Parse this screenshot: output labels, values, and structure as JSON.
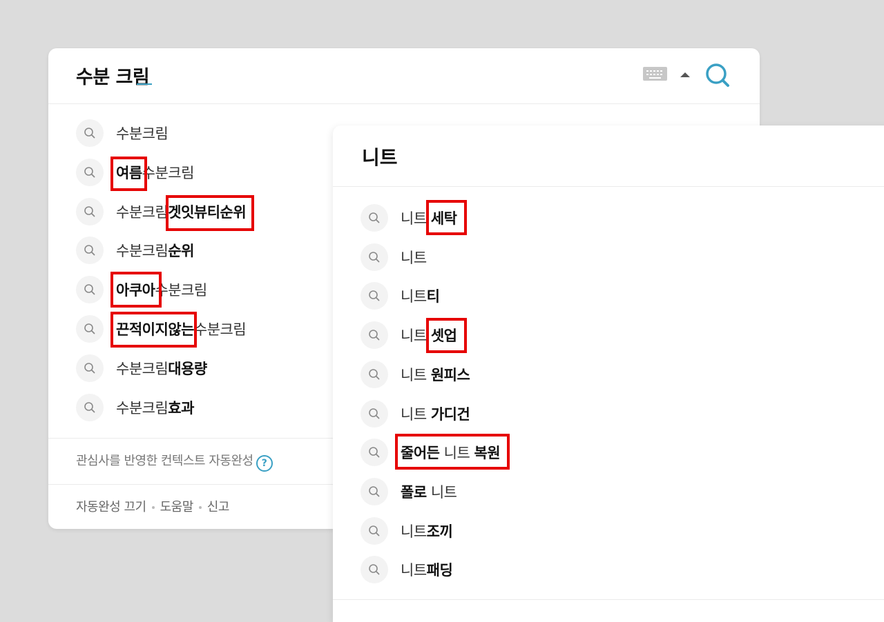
{
  "panel_a": {
    "query": "수분 크림",
    "search_button_label": "검색",
    "suggestions": [
      {
        "plain1": "수분크림",
        "bold": "",
        "plain2": ""
      },
      {
        "plain1": "",
        "bold": "여름",
        "plain2": "수분크림"
      },
      {
        "plain1": "수분크림",
        "bold": "겟잇뷰티순위",
        "plain2": ""
      },
      {
        "plain1": "수분크림",
        "bold": "순위",
        "plain2": ""
      },
      {
        "plain1": "",
        "bold": "아쿠아",
        "plain2": "수분크림"
      },
      {
        "plain1": "",
        "bold": "끈적이지않는",
        "plain2": "수분크림"
      },
      {
        "plain1": "수분크림",
        "bold": "대용량",
        "plain2": ""
      },
      {
        "plain1": "수분크림",
        "bold": "효과",
        "plain2": ""
      }
    ],
    "context_info": "관심사를 반영한 컨텍스트 자동완성",
    "help_icon": "?",
    "footer": {
      "autocomplete_off": "자동완성 끄기",
      "help": "도움말",
      "report": "신고"
    }
  },
  "panel_b": {
    "query": "니트",
    "suggestions": [
      {
        "plain1": "니트 ",
        "bold": "세탁",
        "plain2": ""
      },
      {
        "plain1": "니트",
        "bold": "",
        "plain2": ""
      },
      {
        "plain1": "니트",
        "bold": "티",
        "plain2": ""
      },
      {
        "plain1": "니트 ",
        "bold": "셋업",
        "plain2": ""
      },
      {
        "plain1": "니트 ",
        "bold": "원피스",
        "plain2": ""
      },
      {
        "plain1": "니트 ",
        "bold": "가디건",
        "plain2": ""
      },
      {
        "plain1": "",
        "bold": "줄어든",
        "plain2": " 니트 ",
        "bold2": "복원"
      },
      {
        "plain1": "",
        "bold": "폴로",
        "plain2": " 니트"
      },
      {
        "plain1": "니트",
        "bold": "조끼",
        "plain2": ""
      },
      {
        "plain1": "니트",
        "bold": "패딩",
        "plain2": ""
      }
    ]
  },
  "icons": {
    "row": "search-icon",
    "keyboard": "keyboard-icon",
    "caret": "caret-up-icon",
    "search": "search-icon"
  },
  "colors": {
    "accent": "#3aa0c4",
    "highlight": "#e60000",
    "background": "#dcdcdc"
  }
}
